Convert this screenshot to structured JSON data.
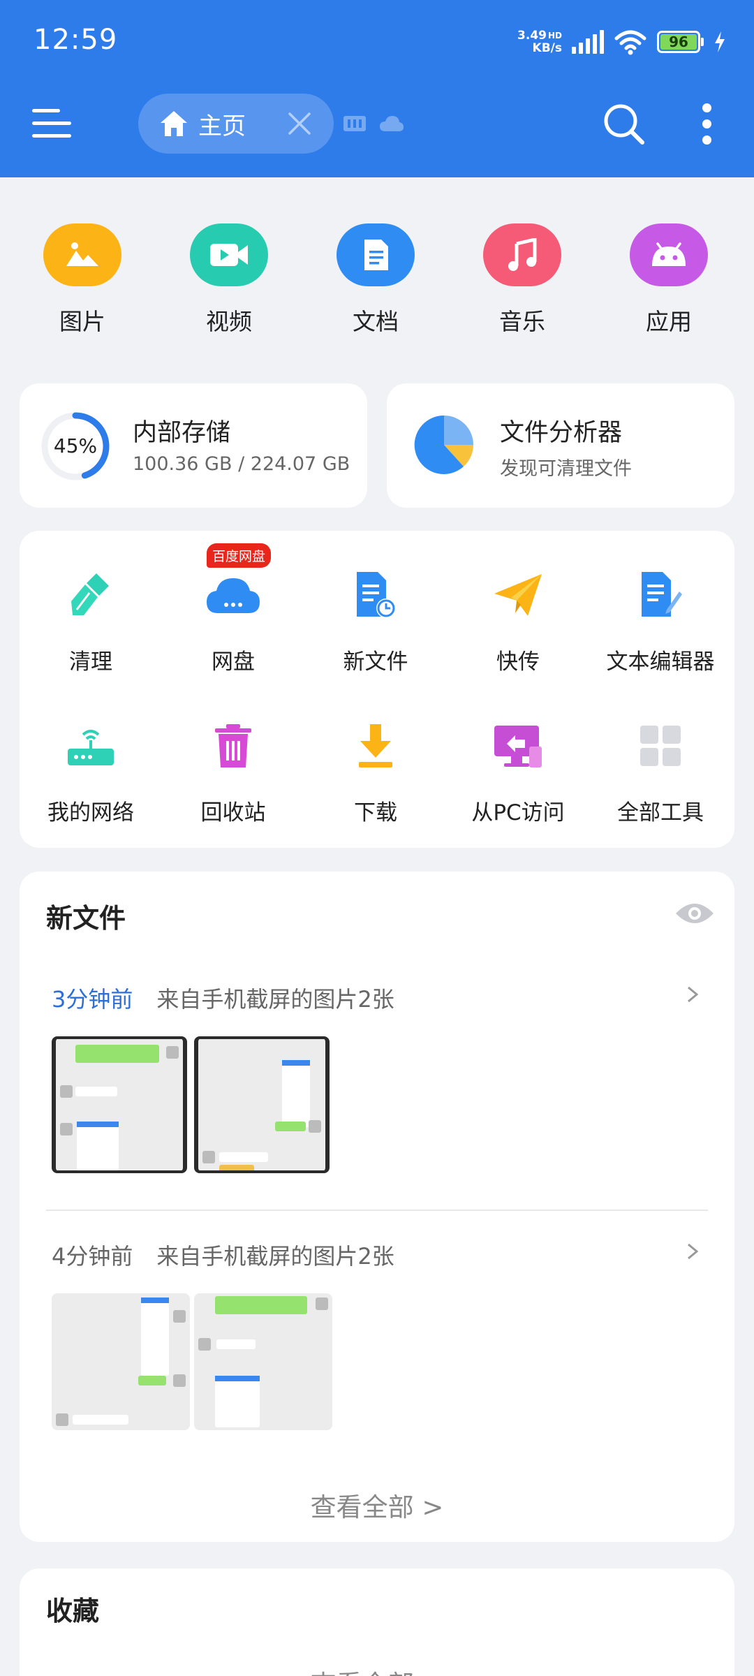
{
  "status_bar": {
    "time": "12:59",
    "net_speed_value": "3.49",
    "net_speed_unit": "KB/s",
    "hd_label": "HD",
    "battery": "96"
  },
  "header": {
    "home_tab_label": "主页"
  },
  "categories": [
    {
      "label": "图片",
      "icon": "image-icon",
      "color": "#fbb316"
    },
    {
      "label": "视频",
      "icon": "video-icon",
      "color": "#27ccb0"
    },
    {
      "label": "文档",
      "icon": "document-icon",
      "color": "#2f8cf2"
    },
    {
      "label": "音乐",
      "icon": "music-icon",
      "color": "#f55a76"
    },
    {
      "label": "应用",
      "icon": "android-icon",
      "color": "#c65ae6"
    }
  ],
  "storage": {
    "title": "内部存储",
    "usage": "100.36 GB / 224.07 GB",
    "percent_label": "45%",
    "percent": 45
  },
  "analyzer": {
    "title": "文件分析器",
    "subtitle": "发现可清理文件"
  },
  "tools": {
    "badge": "百度网盘",
    "items": [
      {
        "label": "清理",
        "icon": "brush-icon"
      },
      {
        "label": "网盘",
        "icon": "cloud-drive-icon"
      },
      {
        "label": "新文件",
        "icon": "new-file-icon"
      },
      {
        "label": "快传",
        "icon": "paper-plane-icon"
      },
      {
        "label": "文本编辑器",
        "icon": "text-editor-icon"
      },
      {
        "label": "我的网络",
        "icon": "router-icon"
      },
      {
        "label": "回收站",
        "icon": "trash-icon"
      },
      {
        "label": "下载",
        "icon": "download-icon"
      },
      {
        "label": "从PC访问",
        "icon": "pc-access-icon"
      },
      {
        "label": "全部工具",
        "icon": "grid-icon"
      }
    ]
  },
  "new_files": {
    "title": "新文件",
    "groups": [
      {
        "time": "3分钟前",
        "desc": "来自手机截屏的图片2张"
      },
      {
        "time": "4分钟前",
        "desc": "来自手机截屏的图片2张"
      }
    ],
    "view_all": "查看全部 >"
  },
  "favorites": {
    "title": "收藏",
    "view_all": "查看全部 >"
  },
  "colors": {
    "header_blue": "#2e7bea",
    "accent_blue": "#2e6fd4",
    "badge_red": "#e8261b"
  }
}
